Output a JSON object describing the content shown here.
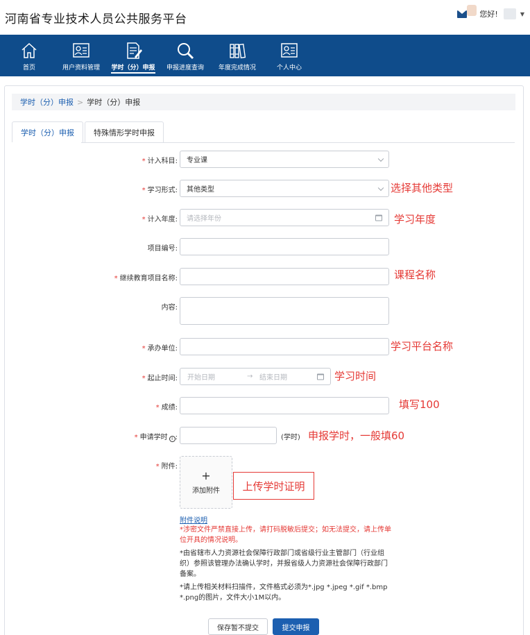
{
  "header": {
    "site_title": "河南省专业技术人员公共服务平台",
    "greeting": "您好!"
  },
  "nav": {
    "items": [
      {
        "label": "首页",
        "icon": "home-icon"
      },
      {
        "label": "用户资料管理",
        "icon": "user-card-icon"
      },
      {
        "label": "学时（分）申报",
        "icon": "document-edit-icon",
        "active": true
      },
      {
        "label": "申报进度查询",
        "icon": "magnifier-icon"
      },
      {
        "label": "年度完成情况",
        "icon": "books-icon"
      },
      {
        "label": "个人中心",
        "icon": "user-card-icon"
      }
    ]
  },
  "breadcrumb": {
    "link": "学时（分）申报",
    "separator": ">",
    "current": "学时（分）申报"
  },
  "tabs": [
    "学时（分）申报",
    "特殊情形学时申报"
  ],
  "form": {
    "subject_label": "计入科目:",
    "subject_value": "专业课",
    "form_label": "学习形式:",
    "form_value": "其他类型",
    "year_label": "计入年度:",
    "year_placeholder": "请选择年份",
    "project_no_label": "项目编号:",
    "project_name_label": "继续教育项目名称:",
    "content_label": "内容:",
    "organizer_label": "承办单位:",
    "period_label": "起止时间:",
    "start_placeholder": "开始日期",
    "range_arrow": "→",
    "end_placeholder": "结束日期",
    "score_label": "成绩:",
    "hours_label": "申请学时",
    "hours_info": "i",
    "hours_colon": ":",
    "hours_unit": "(学时)",
    "attachment_label": "附件:",
    "upload_plus": "+",
    "upload_label": "添加附件",
    "attachment_link": "附件说明",
    "help_red": "*涉密文件严禁直接上传，请打码脱敏后提交；如无法提交，请上传单位开具的情况说明。",
    "help_1": "*由省辖市人力资源社会保障行政部门或省级行业主管部门（行业组织）参照该管理办法确认学时，并报省级人力资源社会保障行政部门备案。",
    "help_2": "*请上传相关材料扫描件，文件格式必须为*.jpg *.jpeg *.gif *.bmp *.png的图片，文件大小1M以内。"
  },
  "annotations": {
    "form": "选择其他类型",
    "year": "学习年度",
    "project_name": "课程名称",
    "organizer": "学习平台名称",
    "period": "学习时间",
    "score": "填写100",
    "hours": "申报学时，一般填60",
    "attachment": "上传学时证明"
  },
  "buttons": {
    "save": "保存暂不提交",
    "submit": "提交申报"
  },
  "colors": {
    "nav_bg": "#0f4c8b",
    "primary": "#1c5fb0",
    "required": "#e53935"
  }
}
